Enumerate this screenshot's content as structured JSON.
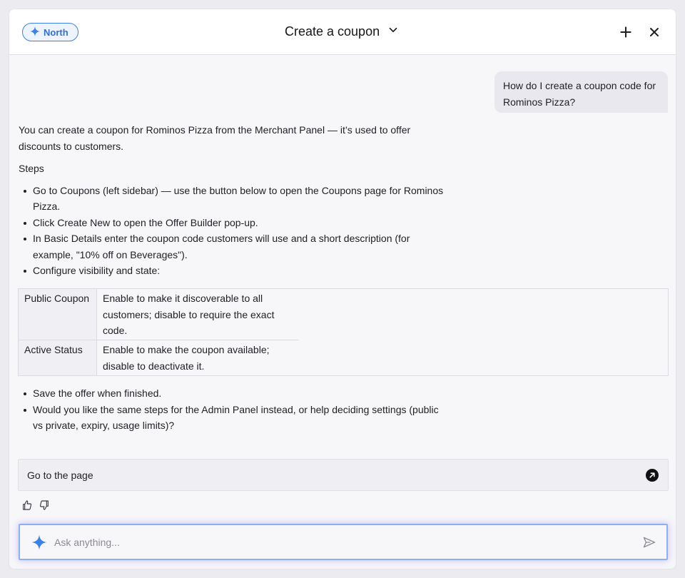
{
  "header": {
    "badge_label": "North",
    "title": "Create a coupon",
    "icons": {
      "new_chat": "plus-icon",
      "close": "close-icon",
      "dropdown": "chevron-down-icon"
    }
  },
  "conversation": {
    "user_message": "How do I create a coupon code for Rominos Pizza?",
    "assistant": {
      "intro": "You can create a coupon for Rominos Pizza from the Merchant Panel — it’s used to offer discounts to customers.",
      "steps_heading": "Steps",
      "steps": [
        "Go to Coupons (left sidebar) — use the button below to open the Coupons page for Rominos Pizza.",
        "Click Create New to open the Offer Builder pop-up.",
        "In Basic Details enter the coupon code customers will use and a short description (for example, \"10% off on Beverages\").",
        "Configure visibility and state:"
      ],
      "table": [
        {
          "setting": "Public Coupon",
          "description": "Enable to make it discoverable to all customers; disable to require the exact code."
        },
        {
          "setting": "Active Status",
          "description": "Enable to make the coupon available; disable to deactivate it."
        }
      ],
      "after_steps": [
        "Save the offer when finished.",
        "Would you like the same steps for the Admin Panel instead, or help deciding settings (public vs private, expiry, usage limits)?"
      ],
      "action_label": "Go to the page"
    }
  },
  "composer": {
    "placeholder": "Ask anything..."
  },
  "colors": {
    "accent": "#3b82e6",
    "composer_border": "#8fb0f0",
    "panel_bg": "#f7f6f9"
  }
}
